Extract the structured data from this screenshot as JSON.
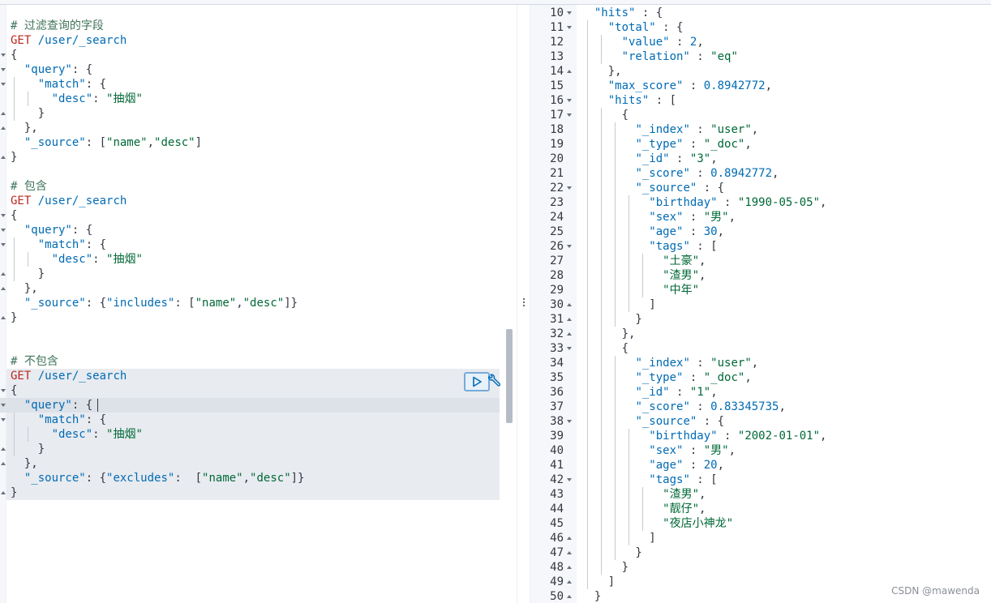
{
  "request": {
    "blocks": [
      {
        "comment": "# 过滤查询的字段",
        "method": "GET",
        "url": "/user/_search",
        "body": [
          [
            {
              "t": "punc",
              "v": "{"
            }
          ],
          [
            {
              "t": "key",
              "v": "  \"query\""
            },
            {
              "t": "punc",
              "v": ": {"
            }
          ],
          [
            {
              "t": "key",
              "v": "    \"match\""
            },
            {
              "t": "punc",
              "v": ": {"
            }
          ],
          [
            {
              "t": "key",
              "v": "      \"desc\""
            },
            {
              "t": "punc",
              "v": ": "
            },
            {
              "t": "str",
              "v": "\"抽烟\""
            }
          ],
          [
            {
              "t": "punc",
              "v": "    }"
            }
          ],
          [
            {
              "t": "punc",
              "v": "  },"
            }
          ],
          [
            {
              "t": "key",
              "v": "  \"_source\""
            },
            {
              "t": "punc",
              "v": ": ["
            },
            {
              "t": "str",
              "v": "\"name\""
            },
            {
              "t": "punc",
              "v": ","
            },
            {
              "t": "str",
              "v": "\"desc\""
            },
            {
              "t": "punc",
              "v": "]"
            }
          ],
          [
            {
              "t": "punc",
              "v": "}"
            }
          ]
        ]
      },
      {
        "comment": "# 包含",
        "method": "GET",
        "url": "/user/_search",
        "body": [
          [
            {
              "t": "punc",
              "v": "{"
            }
          ],
          [
            {
              "t": "key",
              "v": "  \"query\""
            },
            {
              "t": "punc",
              "v": ": {"
            }
          ],
          [
            {
              "t": "key",
              "v": "    \"match\""
            },
            {
              "t": "punc",
              "v": ": {"
            }
          ],
          [
            {
              "t": "key",
              "v": "      \"desc\""
            },
            {
              "t": "punc",
              "v": ": "
            },
            {
              "t": "str",
              "v": "\"抽烟\""
            }
          ],
          [
            {
              "t": "punc",
              "v": "    }"
            }
          ],
          [
            {
              "t": "punc",
              "v": "  },"
            }
          ],
          [
            {
              "t": "key",
              "v": "  \"_source\""
            },
            {
              "t": "punc",
              "v": ": {"
            },
            {
              "t": "key",
              "v": "\"includes\""
            },
            {
              "t": "punc",
              "v": ": ["
            },
            {
              "t": "str",
              "v": "\"name\""
            },
            {
              "t": "punc",
              "v": ","
            },
            {
              "t": "str",
              "v": "\"desc\""
            },
            {
              "t": "punc",
              "v": "]}"
            }
          ],
          [
            {
              "t": "punc",
              "v": "}"
            }
          ]
        ]
      },
      {
        "comment": "# 不包含",
        "method": "GET",
        "url": "/user/_search",
        "body": [
          [
            {
              "t": "punc",
              "v": "{"
            }
          ],
          [
            {
              "t": "key",
              "v": "  \"query\""
            },
            {
              "t": "punc",
              "v": ": {"
            }
          ],
          [
            {
              "t": "key",
              "v": "    \"match\""
            },
            {
              "t": "punc",
              "v": ": {"
            }
          ],
          [
            {
              "t": "key",
              "v": "      \"desc\""
            },
            {
              "t": "punc",
              "v": ": "
            },
            {
              "t": "str",
              "v": "\"抽烟\""
            }
          ],
          [
            {
              "t": "punc",
              "v": "    }"
            }
          ],
          [
            {
              "t": "punc",
              "v": "  },"
            }
          ],
          [
            {
              "t": "key",
              "v": "  \"_source\""
            },
            {
              "t": "punc",
              "v": ": {"
            },
            {
              "t": "key",
              "v": "\"excludes\""
            },
            {
              "t": "punc",
              "v": ":  ["
            },
            {
              "t": "str",
              "v": "\"name\""
            },
            {
              "t": "punc",
              "v": ","
            },
            {
              "t": "str",
              "v": "\"desc\""
            },
            {
              "t": "punc",
              "v": "]}"
            }
          ],
          [
            {
              "t": "punc",
              "v": "}"
            }
          ]
        ]
      }
    ],
    "run_button_icon": "play-icon",
    "settings_button_icon": "wrench-icon"
  },
  "response": {
    "first_line_number": 10,
    "lines": [
      {
        "fold": "down",
        "tokens": [
          {
            "t": "punc",
            "v": "  "
          },
          {
            "t": "key",
            "v": "\"hits\""
          },
          {
            "t": "punc",
            "v": " : {"
          }
        ]
      },
      {
        "fold": "down",
        "tokens": [
          {
            "t": "punc",
            "v": "    "
          },
          {
            "t": "key",
            "v": "\"total\""
          },
          {
            "t": "punc",
            "v": " : {"
          }
        ]
      },
      {
        "fold": "",
        "tokens": [
          {
            "t": "punc",
            "v": "      "
          },
          {
            "t": "key",
            "v": "\"value\""
          },
          {
            "t": "punc",
            "v": " : "
          },
          {
            "t": "num",
            "v": "2"
          },
          {
            "t": "punc",
            "v": ","
          }
        ]
      },
      {
        "fold": "",
        "tokens": [
          {
            "t": "punc",
            "v": "      "
          },
          {
            "t": "key",
            "v": "\"relation\""
          },
          {
            "t": "punc",
            "v": " : "
          },
          {
            "t": "str",
            "v": "\"eq\""
          }
        ]
      },
      {
        "fold": "up",
        "tokens": [
          {
            "t": "punc",
            "v": "    },"
          }
        ]
      },
      {
        "fold": "",
        "tokens": [
          {
            "t": "punc",
            "v": "    "
          },
          {
            "t": "key",
            "v": "\"max_score\""
          },
          {
            "t": "punc",
            "v": " : "
          },
          {
            "t": "num",
            "v": "0.8942772"
          },
          {
            "t": "punc",
            "v": ","
          }
        ]
      },
      {
        "fold": "down",
        "tokens": [
          {
            "t": "punc",
            "v": "    "
          },
          {
            "t": "key",
            "v": "\"hits\""
          },
          {
            "t": "punc",
            "v": " : ["
          }
        ]
      },
      {
        "fold": "down",
        "tokens": [
          {
            "t": "punc",
            "v": "      {"
          }
        ]
      },
      {
        "fold": "",
        "tokens": [
          {
            "t": "punc",
            "v": "        "
          },
          {
            "t": "key",
            "v": "\"_index\""
          },
          {
            "t": "punc",
            "v": " : "
          },
          {
            "t": "str",
            "v": "\"user\""
          },
          {
            "t": "punc",
            "v": ","
          }
        ]
      },
      {
        "fold": "",
        "tokens": [
          {
            "t": "punc",
            "v": "        "
          },
          {
            "t": "key",
            "v": "\"_type\""
          },
          {
            "t": "punc",
            "v": " : "
          },
          {
            "t": "str",
            "v": "\"_doc\""
          },
          {
            "t": "punc",
            "v": ","
          }
        ]
      },
      {
        "fold": "",
        "tokens": [
          {
            "t": "punc",
            "v": "        "
          },
          {
            "t": "key",
            "v": "\"_id\""
          },
          {
            "t": "punc",
            "v": " : "
          },
          {
            "t": "str",
            "v": "\"3\""
          },
          {
            "t": "punc",
            "v": ","
          }
        ]
      },
      {
        "fold": "",
        "tokens": [
          {
            "t": "punc",
            "v": "        "
          },
          {
            "t": "key",
            "v": "\"_score\""
          },
          {
            "t": "punc",
            "v": " : "
          },
          {
            "t": "num",
            "v": "0.8942772"
          },
          {
            "t": "punc",
            "v": ","
          }
        ]
      },
      {
        "fold": "down",
        "tokens": [
          {
            "t": "punc",
            "v": "        "
          },
          {
            "t": "key",
            "v": "\"_source\""
          },
          {
            "t": "punc",
            "v": " : {"
          }
        ]
      },
      {
        "fold": "",
        "tokens": [
          {
            "t": "punc",
            "v": "          "
          },
          {
            "t": "key",
            "v": "\"birthday\""
          },
          {
            "t": "punc",
            "v": " : "
          },
          {
            "t": "str",
            "v": "\"1990-05-05\""
          },
          {
            "t": "punc",
            "v": ","
          }
        ]
      },
      {
        "fold": "",
        "tokens": [
          {
            "t": "punc",
            "v": "          "
          },
          {
            "t": "key",
            "v": "\"sex\""
          },
          {
            "t": "punc",
            "v": " : "
          },
          {
            "t": "str",
            "v": "\"男\""
          },
          {
            "t": "punc",
            "v": ","
          }
        ]
      },
      {
        "fold": "",
        "tokens": [
          {
            "t": "punc",
            "v": "          "
          },
          {
            "t": "key",
            "v": "\"age\""
          },
          {
            "t": "punc",
            "v": " : "
          },
          {
            "t": "num",
            "v": "30"
          },
          {
            "t": "punc",
            "v": ","
          }
        ]
      },
      {
        "fold": "down",
        "tokens": [
          {
            "t": "punc",
            "v": "          "
          },
          {
            "t": "key",
            "v": "\"tags\""
          },
          {
            "t": "punc",
            "v": " : ["
          }
        ]
      },
      {
        "fold": "",
        "tokens": [
          {
            "t": "punc",
            "v": "            "
          },
          {
            "t": "str",
            "v": "\"土豪\""
          },
          {
            "t": "punc",
            "v": ","
          }
        ]
      },
      {
        "fold": "",
        "tokens": [
          {
            "t": "punc",
            "v": "            "
          },
          {
            "t": "str",
            "v": "\"渣男\""
          },
          {
            "t": "punc",
            "v": ","
          }
        ]
      },
      {
        "fold": "",
        "tokens": [
          {
            "t": "punc",
            "v": "            "
          },
          {
            "t": "str",
            "v": "\"中年\""
          }
        ]
      },
      {
        "fold": "up",
        "tokens": [
          {
            "t": "punc",
            "v": "          ]"
          }
        ]
      },
      {
        "fold": "up",
        "tokens": [
          {
            "t": "punc",
            "v": "        }"
          }
        ]
      },
      {
        "fold": "up",
        "tokens": [
          {
            "t": "punc",
            "v": "      },"
          }
        ]
      },
      {
        "fold": "down",
        "tokens": [
          {
            "t": "punc",
            "v": "      {"
          }
        ]
      },
      {
        "fold": "",
        "tokens": [
          {
            "t": "punc",
            "v": "        "
          },
          {
            "t": "key",
            "v": "\"_index\""
          },
          {
            "t": "punc",
            "v": " : "
          },
          {
            "t": "str",
            "v": "\"user\""
          },
          {
            "t": "punc",
            "v": ","
          }
        ]
      },
      {
        "fold": "",
        "tokens": [
          {
            "t": "punc",
            "v": "        "
          },
          {
            "t": "key",
            "v": "\"_type\""
          },
          {
            "t": "punc",
            "v": " : "
          },
          {
            "t": "str",
            "v": "\"_doc\""
          },
          {
            "t": "punc",
            "v": ","
          }
        ]
      },
      {
        "fold": "",
        "tokens": [
          {
            "t": "punc",
            "v": "        "
          },
          {
            "t": "key",
            "v": "\"_id\""
          },
          {
            "t": "punc",
            "v": " : "
          },
          {
            "t": "str",
            "v": "\"1\""
          },
          {
            "t": "punc",
            "v": ","
          }
        ]
      },
      {
        "fold": "",
        "tokens": [
          {
            "t": "punc",
            "v": "        "
          },
          {
            "t": "key",
            "v": "\"_score\""
          },
          {
            "t": "punc",
            "v": " : "
          },
          {
            "t": "num",
            "v": "0.83345735"
          },
          {
            "t": "punc",
            "v": ","
          }
        ]
      },
      {
        "fold": "down",
        "tokens": [
          {
            "t": "punc",
            "v": "        "
          },
          {
            "t": "key",
            "v": "\"_source\""
          },
          {
            "t": "punc",
            "v": " : {"
          }
        ]
      },
      {
        "fold": "",
        "tokens": [
          {
            "t": "punc",
            "v": "          "
          },
          {
            "t": "key",
            "v": "\"birthday\""
          },
          {
            "t": "punc",
            "v": " : "
          },
          {
            "t": "str",
            "v": "\"2002-01-01\""
          },
          {
            "t": "punc",
            "v": ","
          }
        ]
      },
      {
        "fold": "",
        "tokens": [
          {
            "t": "punc",
            "v": "          "
          },
          {
            "t": "key",
            "v": "\"sex\""
          },
          {
            "t": "punc",
            "v": " : "
          },
          {
            "t": "str",
            "v": "\"男\""
          },
          {
            "t": "punc",
            "v": ","
          }
        ]
      },
      {
        "fold": "",
        "tokens": [
          {
            "t": "punc",
            "v": "          "
          },
          {
            "t": "key",
            "v": "\"age\""
          },
          {
            "t": "punc",
            "v": " : "
          },
          {
            "t": "num",
            "v": "20"
          },
          {
            "t": "punc",
            "v": ","
          }
        ]
      },
      {
        "fold": "down",
        "tokens": [
          {
            "t": "punc",
            "v": "          "
          },
          {
            "t": "key",
            "v": "\"tags\""
          },
          {
            "t": "punc",
            "v": " : ["
          }
        ]
      },
      {
        "fold": "",
        "tokens": [
          {
            "t": "punc",
            "v": "            "
          },
          {
            "t": "str",
            "v": "\"渣男\""
          },
          {
            "t": "punc",
            "v": ","
          }
        ]
      },
      {
        "fold": "",
        "tokens": [
          {
            "t": "punc",
            "v": "            "
          },
          {
            "t": "str",
            "v": "\"靓仔\""
          },
          {
            "t": "punc",
            "v": ","
          }
        ]
      },
      {
        "fold": "",
        "tokens": [
          {
            "t": "punc",
            "v": "            "
          },
          {
            "t": "str",
            "v": "\"夜店小神龙\""
          }
        ]
      },
      {
        "fold": "up",
        "tokens": [
          {
            "t": "punc",
            "v": "          ]"
          }
        ]
      },
      {
        "fold": "up",
        "tokens": [
          {
            "t": "punc",
            "v": "        }"
          }
        ]
      },
      {
        "fold": "up",
        "tokens": [
          {
            "t": "punc",
            "v": "      }"
          }
        ]
      },
      {
        "fold": "up",
        "tokens": [
          {
            "t": "punc",
            "v": "    ]"
          }
        ]
      },
      {
        "fold": "up",
        "tokens": [
          {
            "t": "punc",
            "v": "  }"
          }
        ]
      }
    ]
  },
  "watermark": "CSDN @mawenda",
  "colors": {
    "method": "#bd271e",
    "url": "#006bb4",
    "key": "#006bb4",
    "string": "#006837",
    "comment": "#41755c",
    "highlight": "#e8ebf0"
  }
}
